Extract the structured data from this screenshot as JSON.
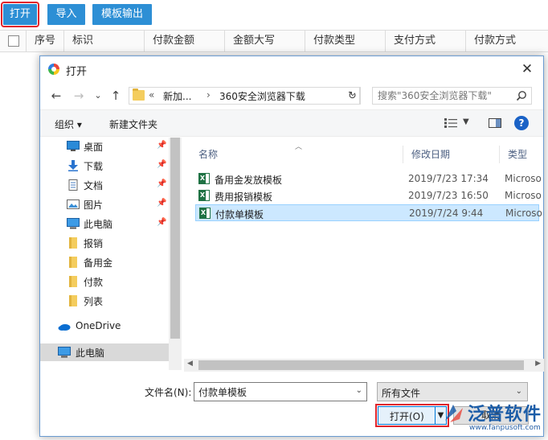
{
  "toolbar": {
    "open_label": "打开",
    "import_label": "导入",
    "template_export_label": "模板输出"
  },
  "grid": {
    "columns": [
      "序号",
      "标识",
      "付款金额",
      "金额大写",
      "付款类型",
      "支付方式",
      "付款方式"
    ]
  },
  "dialog": {
    "title": "打开",
    "close_glyph": "✕",
    "nav": {
      "back": "←",
      "forward": "→",
      "recent": "⌄",
      "up": "↑"
    },
    "address": {
      "chevrons": "«",
      "part1": "新加...",
      "sep": "›",
      "part2": "360安全浏览器下载"
    },
    "search_placeholder": "搜索\"360安全浏览器下载\"",
    "commands": {
      "organize": "组织 ▾",
      "new_folder": "新建文件夹",
      "help": "?"
    },
    "nav_items": [
      {
        "label": "桌面",
        "pinned": true
      },
      {
        "label": "下载",
        "pinned": true
      },
      {
        "label": "文档",
        "pinned": true
      },
      {
        "label": "图片",
        "pinned": true
      },
      {
        "label": "此电脑",
        "pinned": true
      },
      {
        "label": "报销"
      },
      {
        "label": "备用金"
      },
      {
        "label": "付款"
      },
      {
        "label": "列表"
      },
      {
        "label": "OneDrive"
      },
      {
        "label": "此电脑",
        "selected": true
      }
    ],
    "list_headers": {
      "name": "名称",
      "date": "修改日期",
      "type": "类型"
    },
    "files": [
      {
        "name": "备用金发放模板",
        "date": "2019/7/23 17:34",
        "type": "Microso"
      },
      {
        "name": "费用报销模板",
        "date": "2019/7/23 16:50",
        "type": "Microso"
      },
      {
        "name": "付款单模板",
        "date": "2019/7/24 9:44",
        "type": "Microso",
        "selected": true
      }
    ],
    "filename_label": "文件名(N):",
    "filename_value": "付款单模板",
    "filter_value": "所有文件",
    "open_button": "打开(O)",
    "cancel_button": "取消"
  },
  "watermark": {
    "brand": "泛普软件",
    "url": "www.fanpusoft.com"
  },
  "colors": {
    "toolbar_button": "#2d8fd5",
    "highlight_red": "#e0242b",
    "selection": "#cce8ff",
    "brand_blue": "#1c5da8"
  }
}
